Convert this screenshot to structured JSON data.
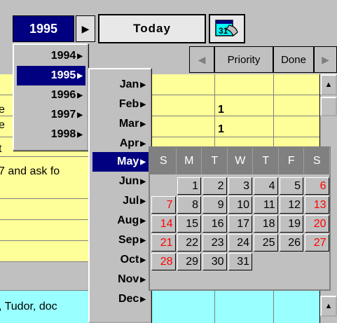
{
  "toolbar": {
    "year": "1995",
    "today_label": "Today",
    "calendar_icon_text": "31"
  },
  "grid": {
    "headers": [
      "Priority",
      "Done"
    ],
    "priority_values": [
      "1",
      "1"
    ],
    "left_fragments": [
      "e",
      "e",
      "t"
    ],
    "text_line_1": "7 and ask fo",
    "text_line_2": ", Tudor, doc"
  },
  "year_menu": {
    "items": [
      "1994",
      "1995",
      "1996",
      "1997",
      "1998"
    ],
    "selected": "1995"
  },
  "month_menu": {
    "items": [
      "Jan",
      "Feb",
      "Mar",
      "Apr",
      "May",
      "Jun",
      "Jul",
      "Aug",
      "Sep",
      "Oct",
      "Nov",
      "Dec"
    ],
    "selected": "May"
  },
  "mini_calendar": {
    "weekdays": [
      "S",
      "M",
      "T",
      "W",
      "T",
      "F",
      "S"
    ],
    "weeks": [
      [
        "",
        "1",
        "2",
        "3",
        "4",
        "5",
        "6"
      ],
      [
        "7",
        "8",
        "9",
        "10",
        "11",
        "12",
        "13"
      ],
      [
        "14",
        "15",
        "16",
        "17",
        "18",
        "19",
        "20"
      ],
      [
        "21",
        "22",
        "23",
        "24",
        "25",
        "26",
        "27"
      ],
      [
        "28",
        "29",
        "30",
        "31",
        "",
        "",
        ""
      ]
    ],
    "weekend_color": "#ff0000"
  },
  "colors": {
    "selection": "#000080",
    "yellow_rows": "#ffff99",
    "cyan_rows": "#99ffff"
  }
}
